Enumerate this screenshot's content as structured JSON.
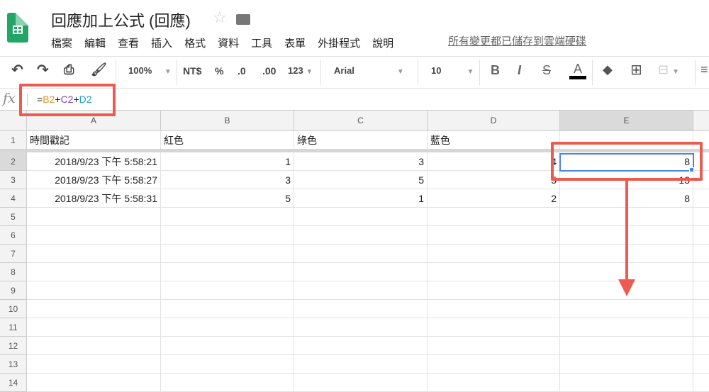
{
  "doc": {
    "title": "回應加上公式 (回應)",
    "saved_status": "所有變更都已儲存到雲端硬碟"
  },
  "menu": [
    "檔案",
    "編輯",
    "查看",
    "插入",
    "格式",
    "資料",
    "工具",
    "表單",
    "外掛程式",
    "說明"
  ],
  "toolbar": {
    "zoom": "100%",
    "currency": "NT$",
    "percent": "%",
    "dec_decrease": ".0",
    "dec_increase": ".00",
    "number_format": "123",
    "font": "Arial",
    "font_size": "10",
    "bold": "B",
    "italic": "I",
    "strike": "S",
    "text_color": "A"
  },
  "formula_bar": {
    "fx": "fx",
    "eq": "=",
    "b2": "B2",
    "p1": "+",
    "c2": "C2",
    "p2": "+",
    "d2": "D2"
  },
  "colors": {
    "b2": "#e69a2b",
    "c2": "#8e44ad",
    "d2": "#1fa3c9",
    "selection": "#4a86e8",
    "annotation": "#ee5a4f"
  },
  "columns": [
    "A",
    "B",
    "C",
    "D",
    "E"
  ],
  "rows": [
    [
      "時間戳記",
      "紅色",
      "綠色",
      "藍色",
      ""
    ],
    [
      "2018/9/23 下午 5:58:21",
      "1",
      "3",
      "4",
      "8"
    ],
    [
      "2018/9/23 下午 5:58:27",
      "3",
      "5",
      "5",
      "13"
    ],
    [
      "2018/9/23 下午 5:58:31",
      "5",
      "1",
      "2",
      "8"
    ]
  ],
  "row_numbers": [
    "1",
    "2",
    "3",
    "4",
    "5",
    "6",
    "7",
    "8",
    "9",
    "10",
    "11",
    "12",
    "13",
    "14"
  ]
}
